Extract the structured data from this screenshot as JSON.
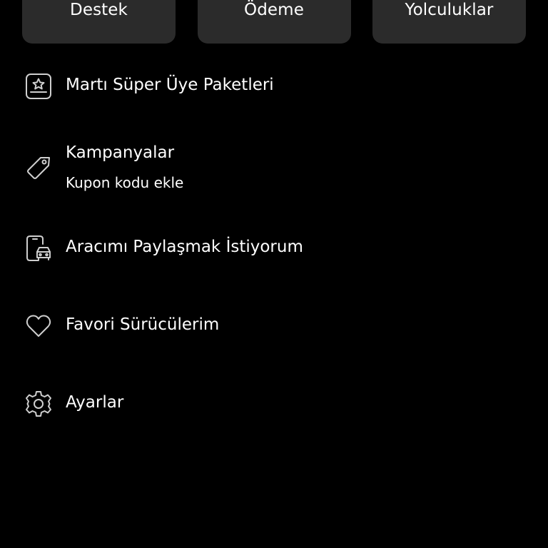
{
  "quick_actions": [
    {
      "label": "Destek"
    },
    {
      "label": "Ödeme"
    },
    {
      "label": "Yolculuklar"
    }
  ],
  "menu": {
    "super_member": {
      "label": "Martı Süper Üye Paketleri",
      "icon": "star-badge-icon"
    },
    "campaigns": {
      "label": "Kampanyalar",
      "sublabel": "Kupon kodu ekle",
      "icon": "tag-icon"
    },
    "share_vehicle": {
      "label": "Aracımı Paylaşmak İstiyorum",
      "icon": "phone-car-icon"
    },
    "favorite_drivers": {
      "label": "Favori Sürücülerim",
      "icon": "heart-icon"
    },
    "settings": {
      "label": "Ayarlar",
      "icon": "gear-icon"
    }
  },
  "colors": {
    "background": "#000000",
    "card": "#2b2b2b",
    "text": "#ffffff",
    "icon": "#cfcfcf"
  }
}
